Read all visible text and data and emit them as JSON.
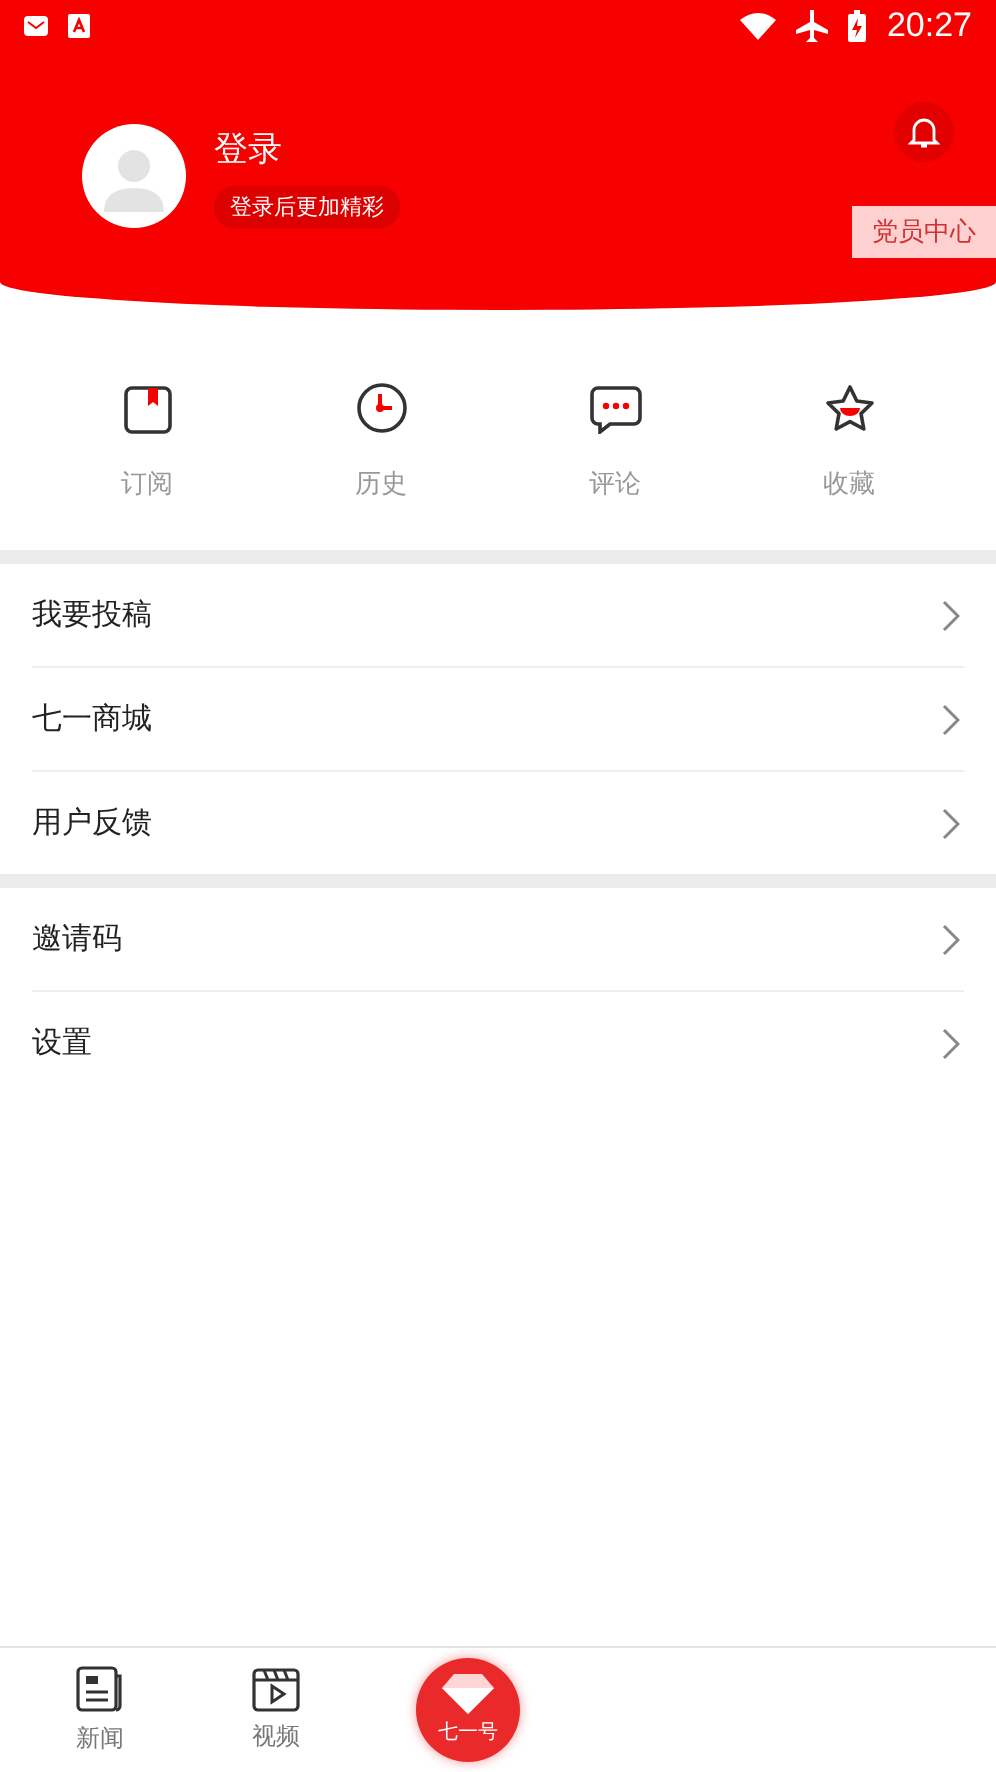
{
  "status_bar": {
    "time": "20:27"
  },
  "profile": {
    "name": "登录",
    "hint": "登录后更加精彩",
    "member_button": "党员中心"
  },
  "shortcuts": [
    {
      "kind": "subscribe",
      "label": "订阅"
    },
    {
      "kind": "history",
      "label": "历史"
    },
    {
      "kind": "comment",
      "label": "评论"
    },
    {
      "kind": "favorite",
      "label": "收藏"
    }
  ],
  "menu_groups": [
    [
      {
        "label": "我要投稿"
      },
      {
        "label": "七一商城"
      },
      {
        "label": "用户反馈"
      }
    ],
    [
      {
        "label": "邀请码"
      },
      {
        "label": "设置"
      }
    ]
  ],
  "bottom_nav": {
    "tabs": [
      {
        "kind": "news",
        "label": "新闻"
      },
      {
        "kind": "video",
        "label": "视频"
      }
    ],
    "center": {
      "label": "七一号"
    }
  }
}
